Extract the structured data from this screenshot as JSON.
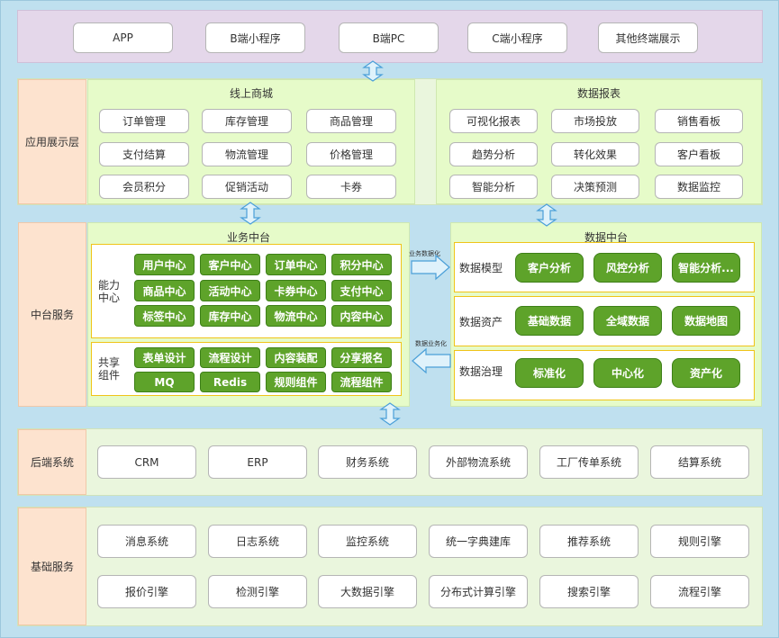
{
  "layers": {
    "presentation": "应用展示层",
    "middle": "中台服务",
    "backend": "后端系统",
    "foundation": "基础服务"
  },
  "terminals": [
    "APP",
    "B端小程序",
    "B端PC",
    "C端小程序",
    "其他终端展示"
  ],
  "online_mall": {
    "title": "线上商城",
    "items": [
      "订单管理",
      "库存管理",
      "商品管理",
      "支付结算",
      "物流管理",
      "价格管理",
      "会员积分",
      "促销活动",
      "卡券"
    ]
  },
  "data_report": {
    "title": "数据报表",
    "items": [
      "可视化报表",
      "市场投放",
      "销售看板",
      "趋势分析",
      "转化效果",
      "客户看板",
      "智能分析",
      "决策预测",
      "数据监控"
    ]
  },
  "business_platform": {
    "title": "业务中台",
    "capability": {
      "label": "能力\n中心",
      "items": [
        "用户中心",
        "客户中心",
        "订单中心",
        "积分中心",
        "商品中心",
        "活动中心",
        "卡券中心",
        "支付中心",
        "标签中心",
        "库存中心",
        "物流中心",
        "内容中心"
      ]
    },
    "shared": {
      "label": "共享\n组件",
      "items": [
        "表单设计",
        "流程设计",
        "内容装配",
        "分享报名",
        "MQ",
        "Redis",
        "规则组件",
        "流程组件"
      ]
    }
  },
  "data_platform": {
    "title": "数据中台",
    "rows": [
      {
        "label": "数据模型",
        "items": [
          "客户分析",
          "风控分析",
          "智能分析..."
        ]
      },
      {
        "label": "数据资产",
        "items": [
          "基础数据",
          "全域数据",
          "数据地图"
        ]
      },
      {
        "label": "数据治理",
        "items": [
          "标准化",
          "中心化",
          "资产化"
        ]
      }
    ]
  },
  "flows": {
    "to_data": "业务数据化",
    "to_business": "数据业务化"
  },
  "backend_systems": [
    "CRM",
    "ERP",
    "财务系统",
    "外部物流系统",
    "工厂传单系统",
    "结算系统"
  ],
  "foundation_services": [
    "消息系统",
    "日志系统",
    "监控系统",
    "统一字典建库",
    "推荐系统",
    "规则引擎",
    "报价引擎",
    "检测引擎",
    "大数据引擎",
    "分布式计算引擎",
    "搜索引擎",
    "流程引擎"
  ],
  "colors": {
    "background": "#bfe0ef",
    "terminal_band": "#e4d7ea",
    "layer_label": "#fde3cf",
    "panel": "#e6fbc9",
    "green_button": "#5ea32a",
    "group_border": "#f0c419",
    "arrow_fill": "#dff2fb",
    "arrow_stroke": "#4a9fd8"
  }
}
